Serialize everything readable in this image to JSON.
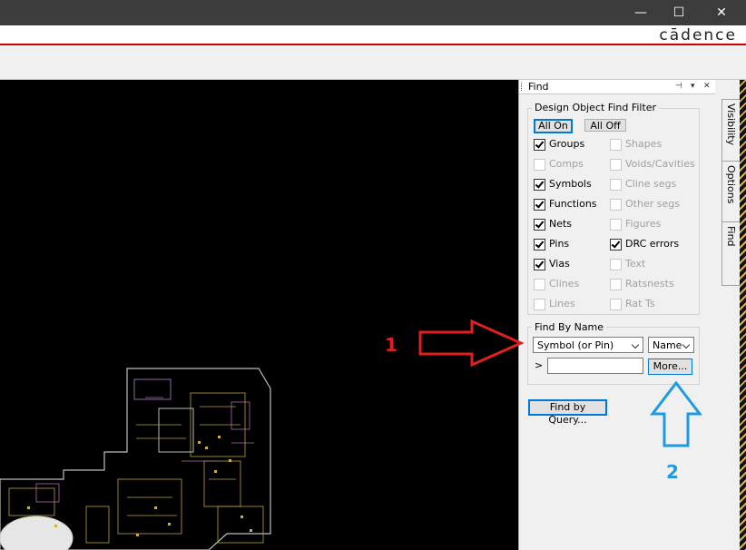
{
  "window": {
    "brand": "cādence",
    "minimize_glyph": "—",
    "maximize_glyph": "☐",
    "close_glyph": "✕"
  },
  "find_panel": {
    "title": "Find",
    "filter": {
      "legend": "Design Object Find Filter",
      "all_on": "All On",
      "all_off": "All Off",
      "left_items": [
        {
          "label": "Groups",
          "checked": true,
          "enabled": true
        },
        {
          "label": "Comps",
          "checked": false,
          "enabled": false
        },
        {
          "label": "Symbols",
          "checked": true,
          "enabled": true
        },
        {
          "label": "Functions",
          "checked": true,
          "enabled": true
        },
        {
          "label": "Nets",
          "checked": true,
          "enabled": true
        },
        {
          "label": "Pins",
          "checked": true,
          "enabled": true
        },
        {
          "label": "Vias",
          "checked": true,
          "enabled": true
        },
        {
          "label": "Clines",
          "checked": false,
          "enabled": false
        },
        {
          "label": "Lines",
          "checked": false,
          "enabled": false
        }
      ],
      "right_items": [
        {
          "label": "Shapes",
          "checked": false,
          "enabled": false
        },
        {
          "label": "Voids/Cavities",
          "checked": false,
          "enabled": false
        },
        {
          "label": "Cline segs",
          "checked": false,
          "enabled": false
        },
        {
          "label": "Other segs",
          "checked": false,
          "enabled": false
        },
        {
          "label": "Figures",
          "checked": false,
          "enabled": false
        },
        {
          "label": "DRC errors",
          "checked": true,
          "enabled": true
        },
        {
          "label": "Text",
          "checked": false,
          "enabled": false
        },
        {
          "label": "Ratsnests",
          "checked": false,
          "enabled": false
        },
        {
          "label": "Rat Ts",
          "checked": false,
          "enabled": false
        }
      ]
    },
    "find_by_name": {
      "legend": "Find By Name",
      "type_value": "Symbol (or Pin)",
      "mode_value": "Name",
      "prompt": ">",
      "name_value": "",
      "more_button": "More..."
    },
    "find_by_query": "Find by Query..."
  },
  "side_tabs": [
    "Visibility",
    "Options",
    "Find"
  ],
  "annotations": {
    "label_1": "1",
    "label_2": "2",
    "arrow1_color": "#e02020",
    "arrow2_color": "#1e9be0"
  }
}
